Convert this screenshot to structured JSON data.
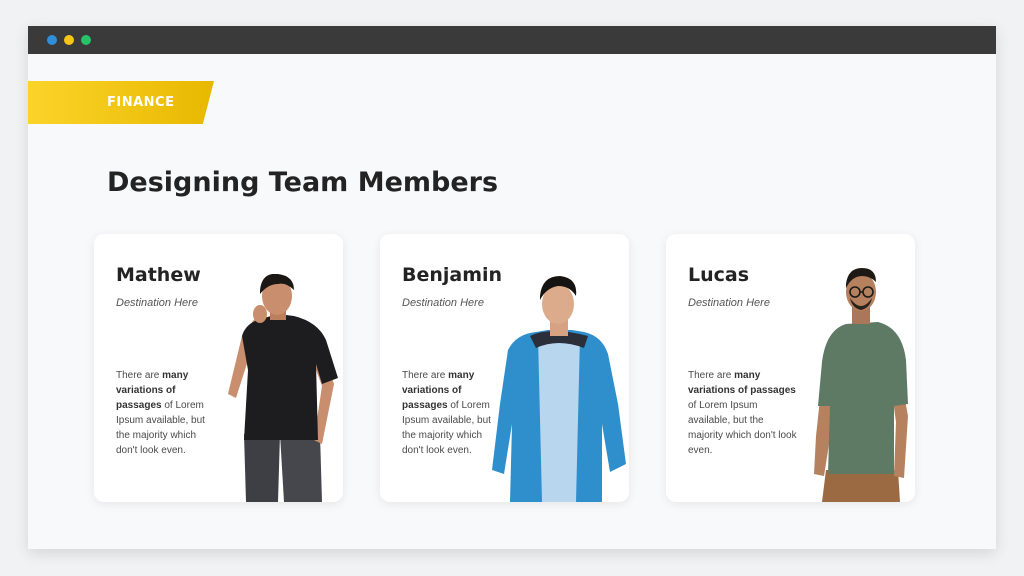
{
  "window": {
    "controls": [
      "blue-dot",
      "yellow-dot",
      "green-dot"
    ]
  },
  "tag": {
    "label": "FINANCE"
  },
  "page_title": "Designing Team Members",
  "members": [
    {
      "name": "Mathew",
      "destination": "Destination  Here",
      "desc_prefix": "There are ",
      "desc_bold": "many variations of passages",
      "desc_suffix": " of Lorem Ipsum available, but the majority which don't look even."
    },
    {
      "name": "Benjamin",
      "destination": "Destination  Here",
      "desc_prefix": "There are ",
      "desc_bold": "many variations of passages",
      "desc_suffix": " of Lorem Ipsum available, but the majority which don't look even."
    },
    {
      "name": "Lucas",
      "destination": "Destination  Here",
      "desc_prefix": "There are ",
      "desc_bold": "many variations of passages",
      "desc_suffix": " of Lorem Ipsum available, but the majority which don't look even."
    }
  ],
  "colors": {
    "titlebar": "#3a3a3a",
    "dot_blue": "#2f8fd8",
    "dot_yellow": "#f5c518",
    "dot_green": "#27c36a",
    "tag_start": "#fbd42a",
    "tag_end": "#e8b800"
  }
}
